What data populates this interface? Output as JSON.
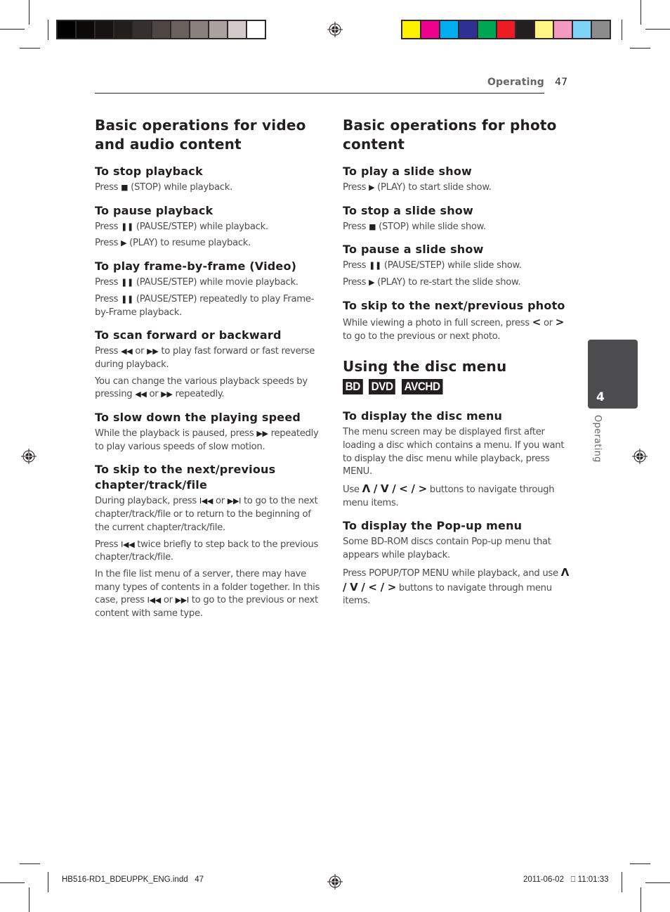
{
  "print_marks": {
    "grayscale_swatches": [
      "#000000",
      "#0c0a09",
      "#171312",
      "#211e1c",
      "#352f2d",
      "#4e4643",
      "#6a605d",
      "#8a807d",
      "#aba19e",
      "#d3cbca",
      "#ffffff"
    ],
    "color_swatches": [
      "#fff200",
      "#ec008c",
      "#00aeef",
      "#2e3192",
      "#00a651",
      "#ed1c24",
      "#231f20",
      "#fff685",
      "#f49ac1",
      "#7fd3f7",
      "#8c8c8c"
    ]
  },
  "header": {
    "section": "Operating",
    "page_number": "47"
  },
  "left_column": {
    "title": "Basic operations for video and audio content",
    "sections": [
      {
        "heading": "To stop playback",
        "paragraphs": [
          {
            "pre": "Press ",
            "icon": "■",
            "icon_name": "stop-icon",
            "post": " (STOP) while playback."
          }
        ]
      },
      {
        "heading": "To pause playback",
        "paragraphs": [
          {
            "pre": "Press ",
            "icon": "❚❚",
            "icon_name": "pause-icon",
            "post": " (PAUSE/STEP) while playback."
          },
          {
            "pre": "Press ",
            "icon": "▶",
            "icon_name": "play-icon",
            "post": " (PLAY) to resume playback."
          }
        ]
      },
      {
        "heading": "To play frame-by-frame (Video)",
        "paragraphs": [
          {
            "pre": "Press ",
            "icon": "❚❚",
            "icon_name": "pause-icon",
            "post": " (PAUSE/STEP) while movie playback."
          },
          {
            "pre": "Press ",
            "icon": "❚❚",
            "icon_name": "pause-icon",
            "post": " (PAUSE/STEP) repeatedly to play Frame-by-Frame playback."
          }
        ]
      },
      {
        "heading": "To scan forward or backward",
        "paragraphs": [
          {
            "pre": "Press ",
            "icon": "◀◀",
            "icon_name": "rewind-icon",
            "mid": " or ",
            "icon2": "▶▶",
            "icon2_name": "fast-forward-icon",
            "post": " to play fast forward or fast reverse during playback."
          },
          {
            "pre": "You can change the various playback speeds by pressing ",
            "icon": "◀◀",
            "icon_name": "rewind-icon",
            "mid": " or ",
            "icon2": "▶▶",
            "icon2_name": "fast-forward-icon",
            "post": " repeatedly."
          }
        ]
      },
      {
        "heading": "To slow down the playing speed",
        "paragraphs": [
          {
            "pre": "While the playback is paused, press ",
            "icon": "▶▶",
            "icon_name": "fast-forward-icon",
            "post": " repeatedly to play various speeds of slow motion."
          }
        ]
      },
      {
        "heading": "To skip to the next/previous chapter/track/file",
        "paragraphs": [
          {
            "pre": "During playback, press ",
            "icon": "I◀◀",
            "icon_name": "skip-previous-icon",
            "mid": " or ",
            "icon2": "▶▶I",
            "icon2_name": "skip-next-icon",
            "post": " to go to the next chapter/track/file or to return to the beginning of the current chapter/track/file."
          },
          {
            "pre": "Press ",
            "icon": "I◀◀",
            "icon_name": "skip-previous-icon",
            "post": " twice briefly to step back to the previous chapter/track/file."
          },
          {
            "pre": "In the file list menu of a server, there may have many types of contents in a folder together. In this case, press ",
            "icon": "I◀◀",
            "icon_name": "skip-previous-icon",
            "mid": " or ",
            "icon2": "▶▶I",
            "icon2_name": "skip-next-icon",
            "post": " to go to the previous or next content with same type."
          }
        ]
      }
    ]
  },
  "right_column": {
    "title": "Basic operations for photo content",
    "sections": [
      {
        "heading": "To play a slide show",
        "paragraphs": [
          {
            "pre": "Press ",
            "icon": "▶",
            "icon_name": "play-icon",
            "post": " (PLAY) to start slide show."
          }
        ]
      },
      {
        "heading": "To stop a slide show",
        "paragraphs": [
          {
            "pre": "Press ",
            "icon": "■",
            "icon_name": "stop-icon",
            "post": " (STOP) while slide show."
          }
        ]
      },
      {
        "heading": "To pause a slide show",
        "paragraphs": [
          {
            "pre": "Press ",
            "icon": "❚❚",
            "icon_name": "pause-icon",
            "post": " (PAUSE/STEP) while slide show."
          },
          {
            "pre": "Press ",
            "icon": "▶",
            "icon_name": "play-icon",
            "post": " (PLAY) to re-start the slide show."
          }
        ]
      },
      {
        "heading": "To skip to the next/previous photo",
        "paragraphs": [
          {
            "pre": "While viewing a photo in full screen, press ",
            "icon": "<",
            "icon_name": "left-arrow-icon",
            "mid": " or ",
            "icon2": ">",
            "icon2_name": "right-arrow-icon",
            "post": " to go to the previous or next photo."
          }
        ]
      }
    ],
    "disc_menu": {
      "title": "Using the disc menu",
      "badges": [
        "BD",
        "DVD",
        "AVCHD"
      ],
      "sections": [
        {
          "heading": "To display the disc menu",
          "paragraphs": [
            {
              "pre": "The menu screen may be displayed first after loading a disc which contains a menu. If you want to display the disc menu while playback, press MENU."
            },
            {
              "pre": "Use ",
              "icon": "Λ / V / < / >",
              "icon_name": "navigation-arrows-icon",
              "post": " buttons to navigate through menu items."
            }
          ]
        },
        {
          "heading": "To display the Pop-up menu",
          "paragraphs": [
            {
              "pre": "Some BD-ROM discs contain Pop-up menu that appears while playback."
            },
            {
              "pre": "Press POPUP/TOP MENU while playback, and use ",
              "icon": "Λ / V / < / >",
              "icon_name": "navigation-arrows-icon",
              "post": " buttons to navigate through menu items."
            }
          ]
        }
      ]
    }
  },
  "chapter_tab": {
    "number": "4",
    "label": "Operating"
  },
  "footer": {
    "file_name": "HB516-RD1_BDEUPPK_ENG.indd   47",
    "timestamp": "2011-06-02   ⎕ 11:01:33"
  }
}
